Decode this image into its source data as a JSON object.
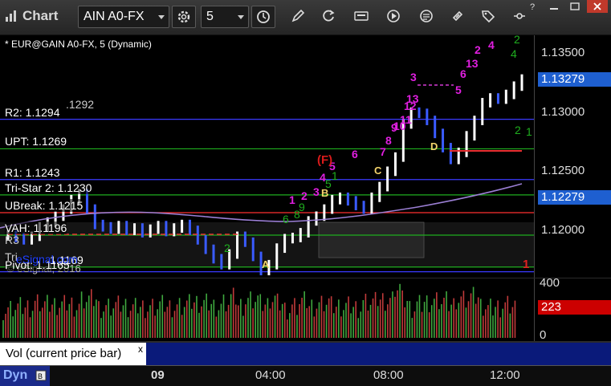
{
  "app": {
    "title": "Chart"
  },
  "toolbar": {
    "symbol": "AIN A0-FX",
    "interval": "5"
  },
  "chart": {
    "header": "* EUR@GAIN A0-FX, 5 (Dynamic)",
    "copyright": "© eSignal, 2016",
    "levels": [
      {
        "label": "R2: 1.1294",
        "value": 1.1294,
        "color": "#3a3aff"
      },
      {
        "label": "UPT: 1.1269",
        "value": 1.1269,
        "color": "#1fae1f"
      },
      {
        "label": "R1: 1.1243",
        "value": 1.1243,
        "color": "#3a3aff"
      },
      {
        "label": "Tri-Star 2: 1.1230",
        "value": 1.123,
        "color": "#1fae1f"
      },
      {
        "label": "UBreak: 1.1215",
        "value": 1.1215,
        "color": "#ff3030"
      },
      {
        "label": "VAH: 1.1196",
        "value": 1.1196,
        "color": "#1fae1f"
      },
      {
        "label": "Pivot: 1.1165",
        "value": 1.1165,
        "color": "#3a3aff"
      },
      {
        "label": "1.1169",
        "value": 1.1169,
        "color": "#1fae1f"
      }
    ],
    "partial_labels": [
      ".1292",
      "R3",
      "Tri",
      "eSignal.com",
      "2"
    ],
    "price_tags": [
      {
        "label": "1.13279",
        "value": 1.13279,
        "bg": "#1e5fd0",
        "fg": "#ffffff"
      },
      {
        "label": "1.12279",
        "value": 1.12279,
        "bg": "#1e5fd0",
        "fg": "#ffffff"
      }
    ],
    "right_ticks": [
      "1.13500",
      "1.13000",
      "1.12500",
      "1.12000"
    ],
    "magenta_counts": [
      "1",
      "2",
      "3",
      "4",
      "5",
      "6",
      "7",
      "8",
      "9",
      "10",
      "11",
      "12",
      "13",
      "5",
      "6",
      "13",
      "2",
      "3",
      "4"
    ],
    "green_counts": [
      "1",
      "2",
      "4",
      "9",
      "8",
      "6",
      "5",
      "1",
      "2"
    ],
    "letter_marks": [
      "A",
      "B",
      "C",
      "D"
    ],
    "f_mark": "(F)"
  },
  "volume": {
    "label": "Vol (current price bar)",
    "close": "x",
    "ticks": [
      "400",
      "0"
    ],
    "current_tag": "223",
    "current_bg": "#cc0000"
  },
  "time_axis": {
    "dyn": "Dyn",
    "labels": [
      "09",
      "04:00",
      "08:00",
      "12:00"
    ]
  },
  "chart_data": {
    "type": "line",
    "x": [
      0,
      1,
      2,
      3,
      4,
      5,
      6,
      7,
      8,
      9,
      10,
      11,
      12,
      13,
      14,
      15,
      16,
      17,
      18,
      19,
      20,
      21,
      22,
      23,
      24,
      25,
      26,
      27,
      28,
      29,
      30,
      31,
      32,
      33,
      34,
      35,
      36,
      37,
      38,
      39,
      40,
      41,
      42,
      43,
      44,
      45,
      46,
      47,
      48,
      49,
      50,
      51,
      52,
      53,
      54,
      55,
      56,
      57,
      58,
      59,
      60,
      61,
      62,
      63,
      64,
      65
    ],
    "y": [
      1.1196,
      1.1194,
      1.1192,
      1.1195,
      1.1203,
      1.1207,
      1.1212,
      1.1218,
      1.1226,
      1.1231,
      1.1218,
      1.1205,
      1.1203,
      1.1201,
      1.1204,
      1.12,
      1.1202,
      1.1198,
      1.1201,
      1.1204,
      1.1199,
      1.1202,
      1.1205,
      1.12,
      1.1192,
      1.1184,
      1.1176,
      1.1171,
      1.118,
      1.1195,
      1.119,
      1.1178,
      1.1166,
      1.1171,
      1.1185,
      1.1193,
      1.1194,
      1.1198,
      1.1208,
      1.1212,
      1.1218,
      1.1226,
      1.1228,
      1.1225,
      1.1221,
      1.1218,
      1.1228,
      1.1237,
      1.125,
      1.1262,
      1.129,
      1.13,
      1.1299,
      1.1293,
      1.1282,
      1.127,
      1.126,
      1.1266,
      1.128,
      1.1293,
      1.1308,
      1.1312,
      1.1311,
      1.1315,
      1.1322,
      1.1328
    ],
    "ylim": [
      1.116,
      1.1365
    ]
  }
}
